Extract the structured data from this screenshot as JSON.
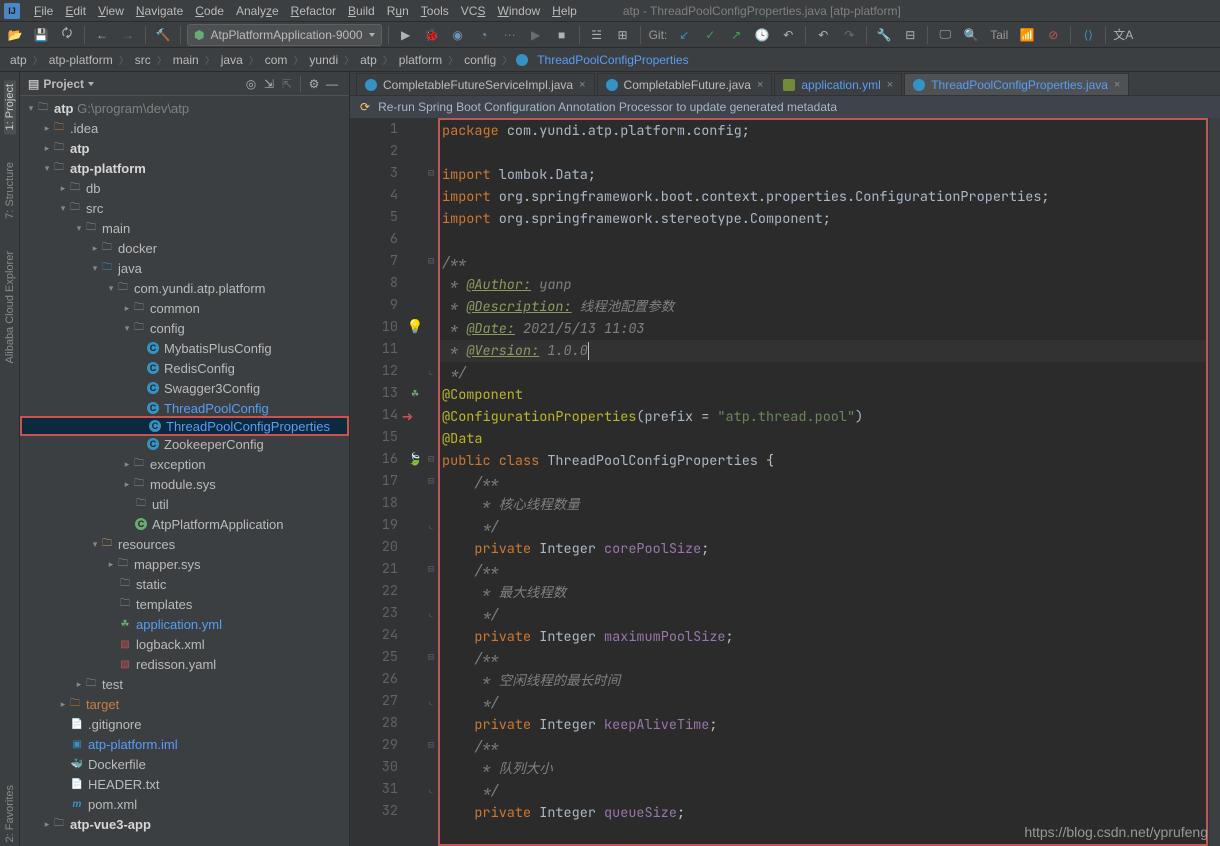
{
  "window_title": "atp - ThreadPoolConfigProperties.java [atp-platform]",
  "menu": [
    "File",
    "Edit",
    "View",
    "Navigate",
    "Code",
    "Analyze",
    "Refactor",
    "Build",
    "Run",
    "Tools",
    "VCS",
    "Window",
    "Help"
  ],
  "run_config": "AtpPlatformApplication-9000",
  "git_label": "Git:",
  "tail_label": "Tail",
  "breadcrumbs": [
    "atp",
    "atp-platform",
    "src",
    "main",
    "java",
    "com",
    "yundi",
    "atp",
    "platform",
    "config",
    "ThreadPoolConfigProperties"
  ],
  "project_panel_title": "Project",
  "left_tabs": [
    "1: Project",
    "7: Structure",
    "Alibaba Cloud Explorer",
    "2: Favorites"
  ],
  "tree": {
    "root": {
      "label": "atp",
      "path": "G:\\program\\dev\\atp"
    },
    "idea": ".idea",
    "atp_mod": "atp",
    "platform": "atp-platform",
    "db": "db",
    "src": "src",
    "main": "main",
    "docker": "docker",
    "java": "java",
    "package": "com.yundi.atp.platform",
    "common": "common",
    "config": "config",
    "configs": [
      "MybatisPlusConfig",
      "RedisConfig",
      "Swagger3Config",
      "ThreadPoolConfig",
      "ThreadPoolConfigProperties",
      "ZookeeperConfig"
    ],
    "exception": "exception",
    "module": "module.sys",
    "util": "util",
    "app": "AtpPlatformApplication",
    "resources": "resources",
    "mapper": "mapper.sys",
    "static": "static",
    "templates": "templates",
    "yml": "application.yml",
    "logback": "logback.xml",
    "redisson": "redisson.yaml",
    "test": "test",
    "target": "target",
    "gitignore": ".gitignore",
    "iml": "atp-platform.iml",
    "dockerfile": "Dockerfile",
    "header": "HEADER.txt",
    "pom": "pom.xml",
    "vue": "atp-vue3-app"
  },
  "editor_tabs": [
    "CompletableFutureServiceImpl.java",
    "CompletableFuture.java",
    "application.yml",
    "ThreadPoolConfigProperties.java"
  ],
  "active_tab": 3,
  "banner": "Re-run Spring Boot Configuration Annotation Processor to update generated metadata",
  "code": {
    "1": "package com.yundi.atp.platform.config;",
    "3": "import lombok.Data;",
    "4": "import org.springframework.boot.context.properties.ConfigurationProperties;",
    "5": "import org.springframework.stereotype.Component;",
    "7": "/**",
    "8_tag": "@Author:",
    "8_val": " yanp",
    "9_tag": "@Description:",
    "9_val": " 线程池配置参数",
    "10_tag": "@Date:",
    "10_val": " 2021/5/13 11:03",
    "11_tag": "@Version:",
    "11_val": " 1.0.0",
    "12": " */",
    "13": "@Component",
    "14a": "@ConfigurationProperties",
    "14b": "(prefix = ",
    "14c": "\"atp.thread.pool\"",
    "14d": ")",
    "15": "@Data",
    "16": "public class ThreadPoolConfigProperties {",
    "17": "    /**",
    "18": "     * 核心线程数量",
    "19": "     */",
    "20": "    private Integer corePoolSize;",
    "21": "    /**",
    "22": "     * 最大线程数",
    "23": "     */",
    "24": "    private Integer maximumPoolSize;",
    "25": "    /**",
    "26": "     * 空闲线程的最长时间",
    "27": "     */",
    "28": "    private Integer keepAliveTime;",
    "29": "    /**",
    "30": "     * 队列大小",
    "31": "     */",
    "32": "    private Integer queueSize;"
  },
  "watermark": "https://blog.csdn.net/yprufeng"
}
